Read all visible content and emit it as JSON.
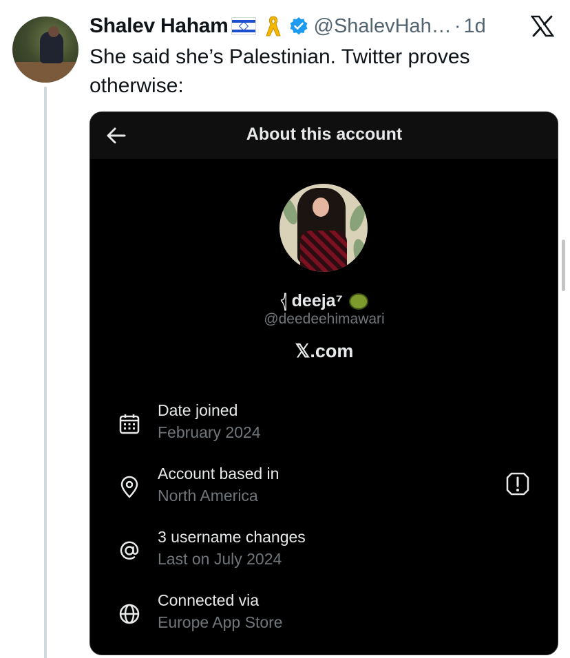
{
  "tweet": {
    "author_name": "Shalev Haham",
    "handle": "@ShalevHah…",
    "separator": "·",
    "time": "1d",
    "text": "She said she’s Palestinian. Twitter proves otherwise:"
  },
  "about_card": {
    "title": "About this account",
    "display_name": "deeja⁷",
    "name_prefix": "𓂆",
    "handle": "@deedeehimawari",
    "domain": "𝕏.com",
    "rows": [
      {
        "label": "Date joined",
        "value": "February 2024",
        "icon": "calendar-icon"
      },
      {
        "label": "Account based in",
        "value": "North America",
        "icon": "location-pin-icon"
      },
      {
        "label": "3 username changes",
        "value": "Last on July 2024",
        "icon": "at-sign-icon"
      },
      {
        "label": "Connected via",
        "value": "Europe App Store",
        "icon": "globe-icon"
      }
    ]
  },
  "colors": {
    "verified_blue": "#1d9bf0",
    "ribbon_yellow": "#f5b800",
    "card_bg": "#000000",
    "secondary_text": "#71767b"
  }
}
